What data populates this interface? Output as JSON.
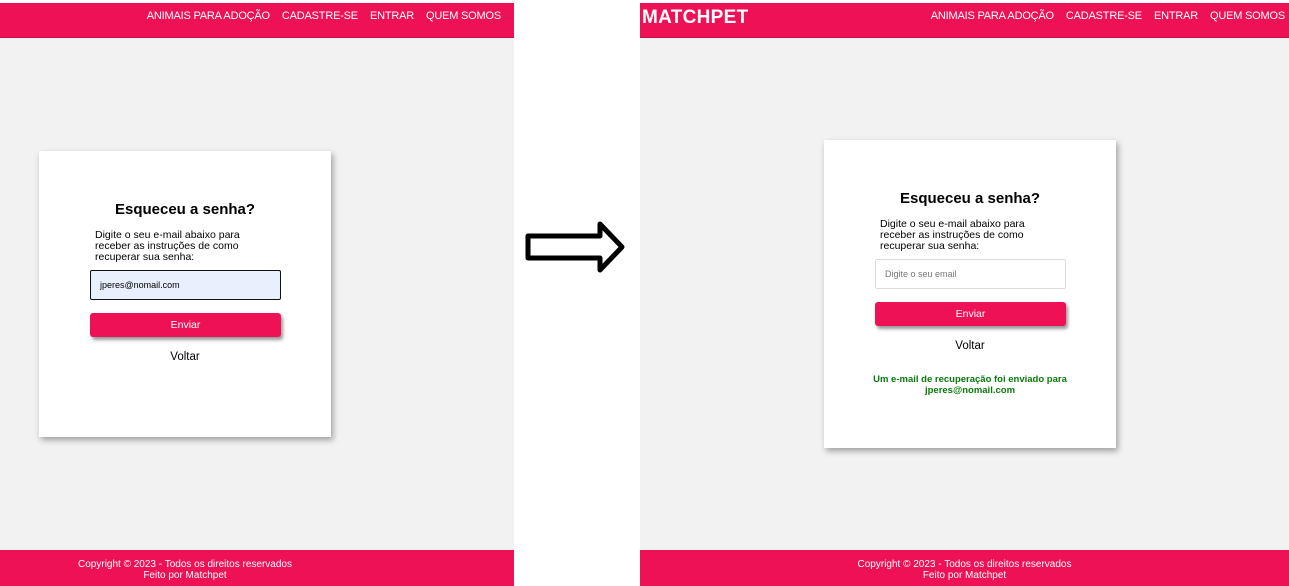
{
  "colors": {
    "brand": "#ef1155",
    "page_bg": "#f2f2f2",
    "success": "#0a7a0a"
  },
  "nav": {
    "brand": "MATCHPET",
    "links": [
      "ANIMAIS PARA ADOÇÃO",
      "CADASTRE-SE",
      "ENTRAR",
      "QUEM SOMOS"
    ]
  },
  "card": {
    "title": "Esqueceu a senha?",
    "instructions": "Digite o seu e-mail abaixo para receber as instruções de como recuperar sua senha:",
    "email_placeholder": "Digite o seu email",
    "button_label": "Enviar",
    "back_label": "Voltar"
  },
  "before": {
    "email_value": "jperes@nomail.com"
  },
  "after": {
    "success_message": "Um e-mail de recuperação foi enviado para jperes@nomail.com"
  },
  "footer": {
    "line1": "Copyright © 2023 - Todos os direitos reservados",
    "line2": "Feito por Matchpet"
  },
  "transition_icon": "right-arrow-icon"
}
